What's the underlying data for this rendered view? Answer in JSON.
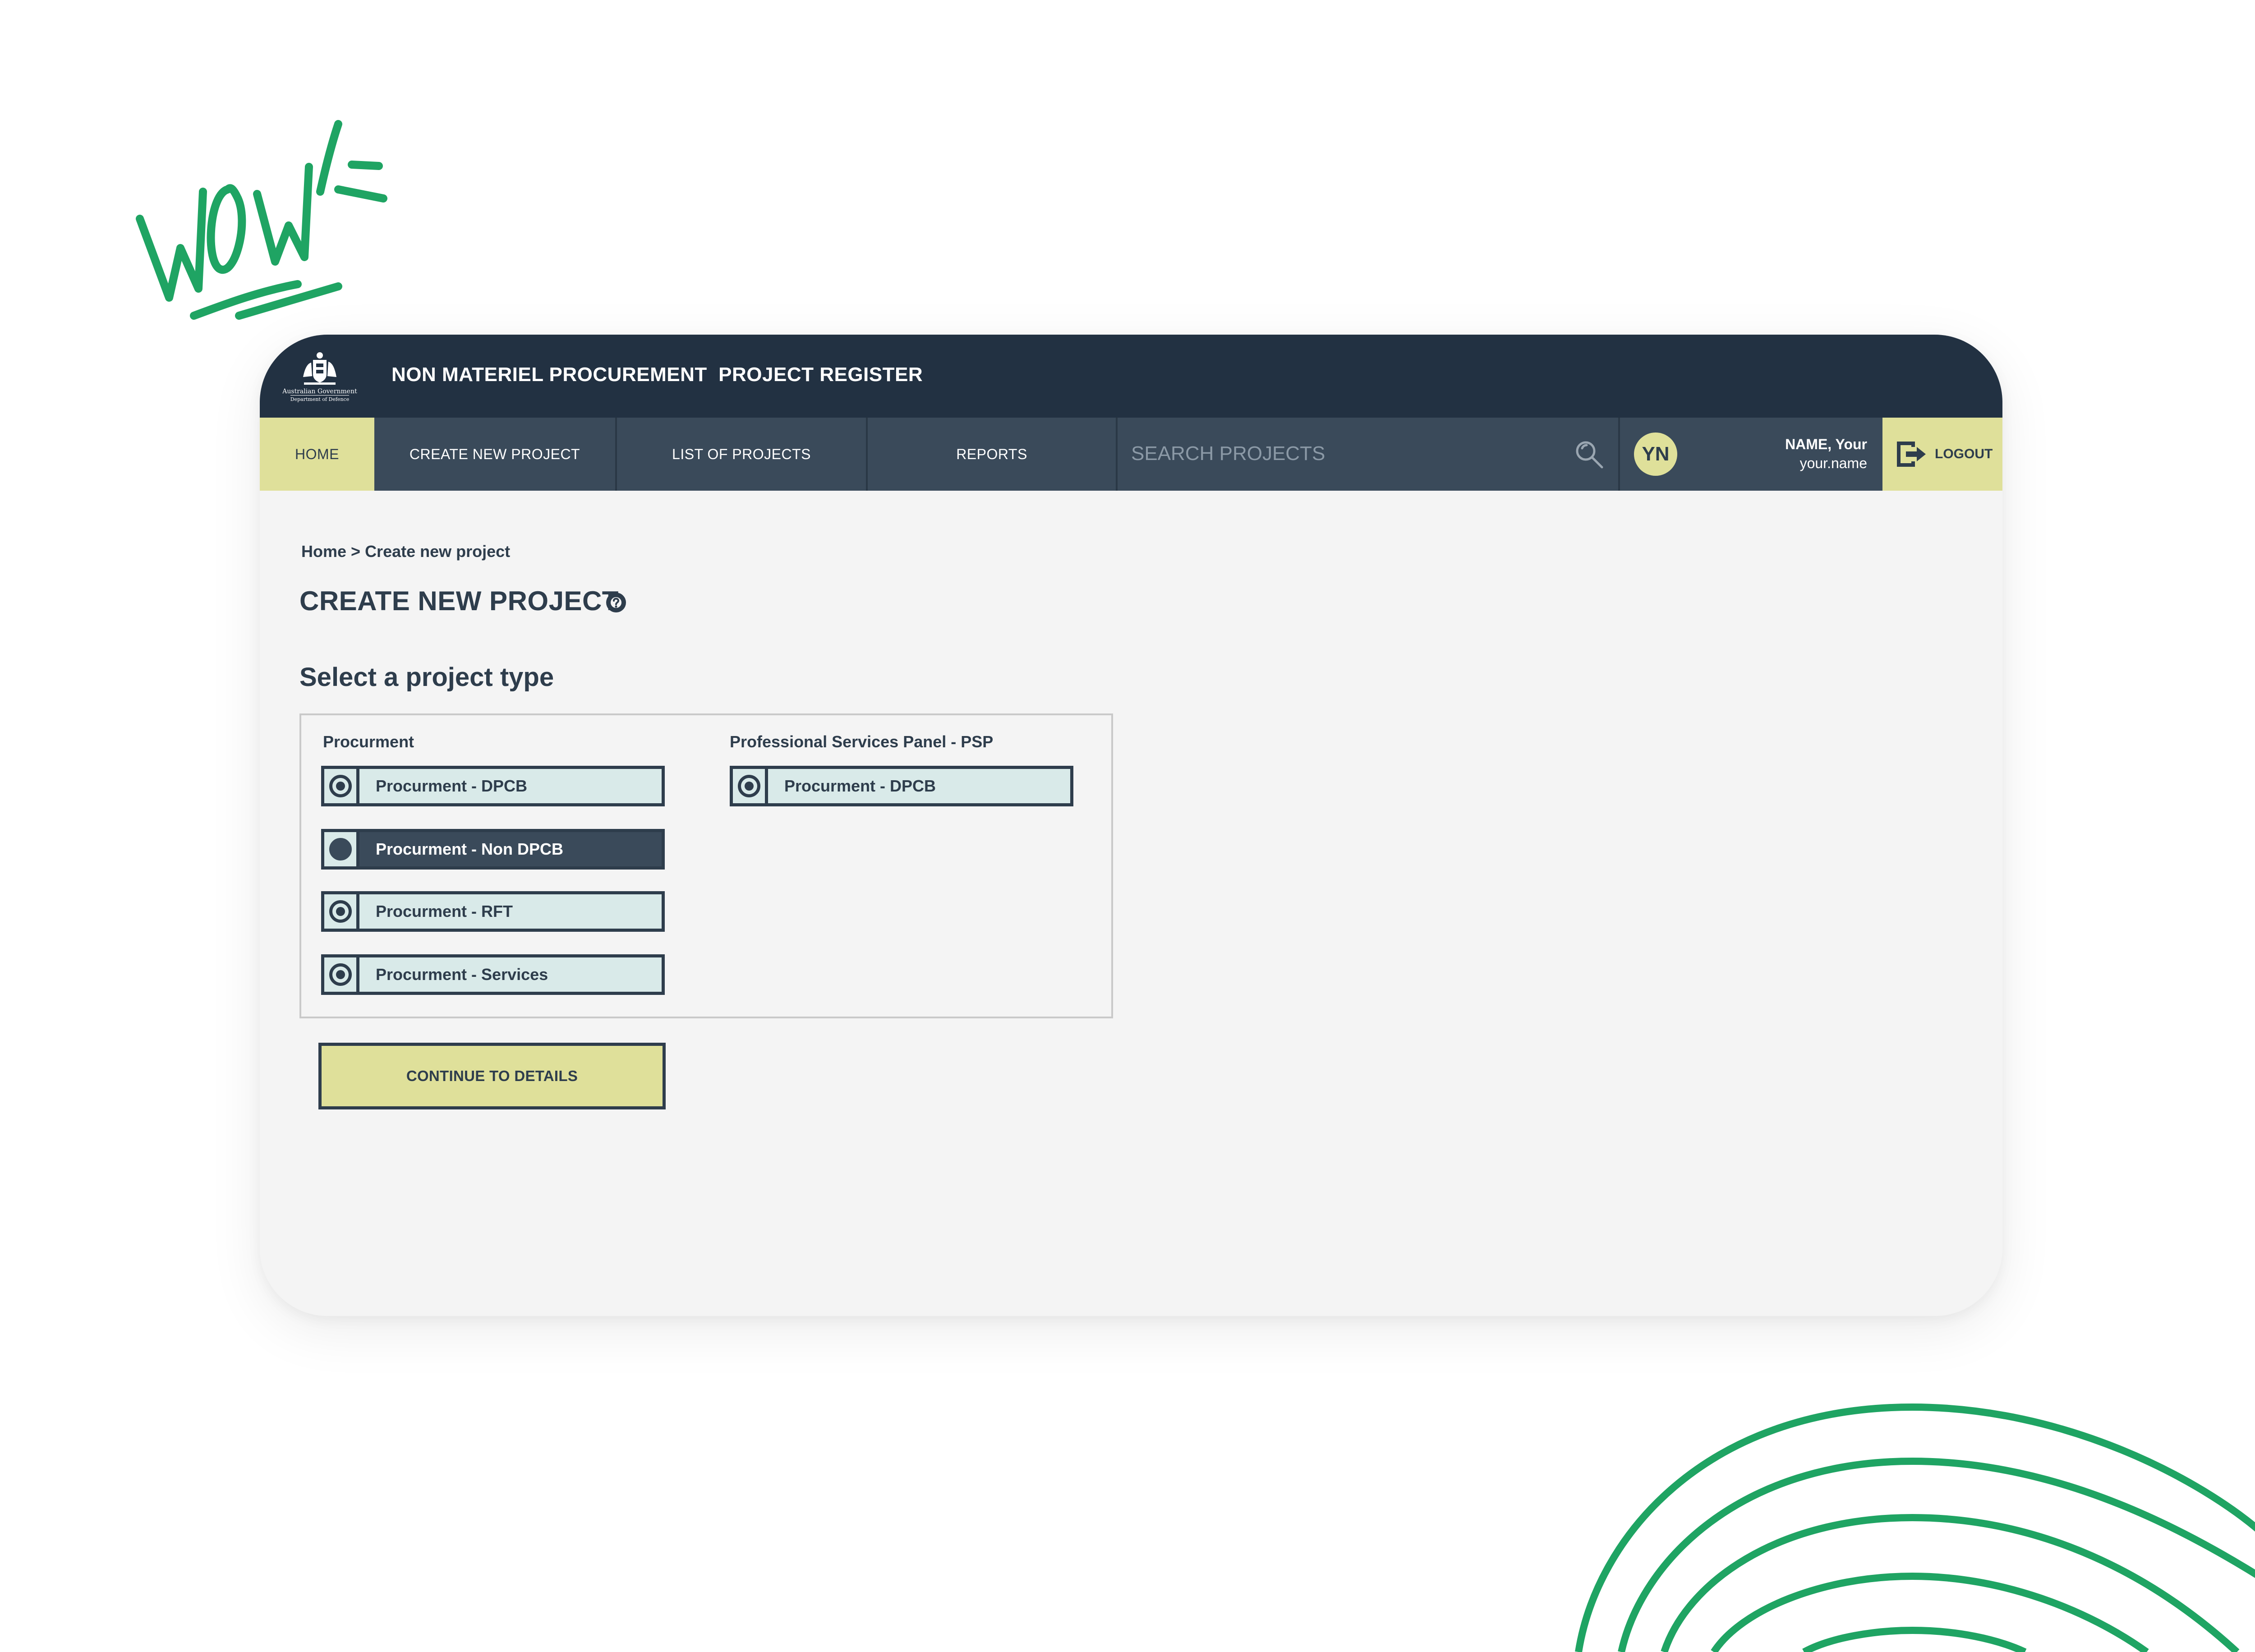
{
  "header": {
    "logo_line1": "Australian Government",
    "logo_line2": "Department of Defence",
    "app_title": "NON MATERIEL PROCUREMENT  PROJECT REGISTER"
  },
  "nav": {
    "items": [
      {
        "label": "HOME",
        "active": true
      },
      {
        "label": "CREATE NEW PROJECT",
        "active": false
      },
      {
        "label": "LIST OF PROJECTS",
        "active": false
      },
      {
        "label": "REPORTS",
        "active": false
      }
    ],
    "search_placeholder": "SEARCH PROJECTS",
    "user": {
      "initials": "YN",
      "name": "NAME, Your",
      "handle": "your.name"
    },
    "logout_label": "LOGOUT"
  },
  "page": {
    "breadcrumb": {
      "home": "Home",
      "separator": " > ",
      "current": "Create new project"
    },
    "title": "CREATE NEW PROJECT",
    "section_heading": "Select a project type",
    "groups": [
      {
        "label": "Procurment",
        "options": [
          {
            "label": "Procurment - DPCB",
            "selected": false
          },
          {
            "label": "Procurment - Non DPCB",
            "selected": true
          },
          {
            "label": "Procurment - RFT",
            "selected": false
          },
          {
            "label": "Procurment - Services",
            "selected": false
          }
        ]
      },
      {
        "label": "Professional Services Panel - PSP",
        "options": [
          {
            "label": "Procurment - DPCB",
            "selected": false
          }
        ]
      }
    ],
    "continue_label": "CONTINUE TO DETAILS"
  },
  "colors": {
    "header_bg": "#223142",
    "nav_bg": "#3a4a5a",
    "accent": "#dfe09a",
    "option_bg": "#d9eae9",
    "doodle_green": "#1fa463"
  }
}
